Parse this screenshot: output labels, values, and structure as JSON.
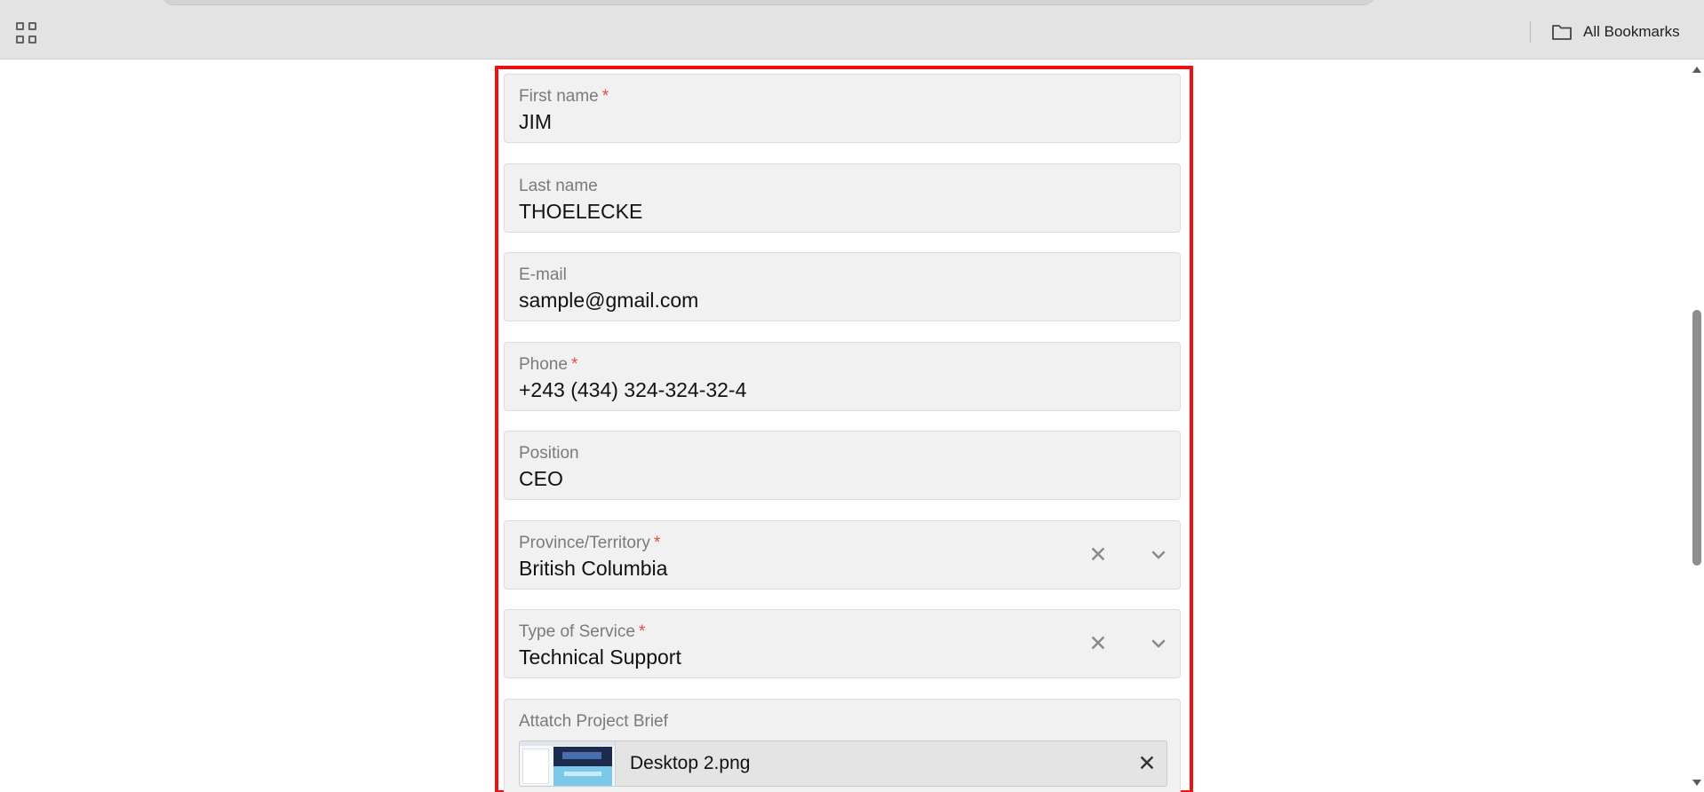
{
  "browser": {
    "bookmarks_label": "All Bookmarks"
  },
  "form": {
    "first_name": {
      "label": "First name",
      "required_mark": "*",
      "value": "JIM"
    },
    "last_name": {
      "label": "Last name",
      "value": "THOELECKE"
    },
    "email": {
      "label": "E-mail",
      "value": "sample@gmail.com"
    },
    "phone": {
      "label": "Phone",
      "required_mark": "*",
      "value": "+243 (434) 324-324-32-4"
    },
    "position": {
      "label": "Position",
      "value": "CEO"
    },
    "province": {
      "label": "Province/Territory",
      "required_mark": "*",
      "value": "British Columbia",
      "clear_glyph": "✕"
    },
    "service": {
      "label": "Type of Service",
      "required_mark": "*",
      "value": "Technical Support",
      "clear_glyph": "✕"
    },
    "attachment": {
      "label": "Attatch Project Brief",
      "file_name": "Desktop 2.png",
      "remove_glyph": "✕"
    }
  },
  "colors": {
    "highlight_border": "#ee1111",
    "required_asterisk": "#e84c3d",
    "field_background": "#f1f1f1"
  },
  "icons": {
    "apps": "apps-grid-icon",
    "bookmarks": "folder-icon",
    "clear": "close-icon",
    "dropdown": "chevron-down-icon"
  }
}
